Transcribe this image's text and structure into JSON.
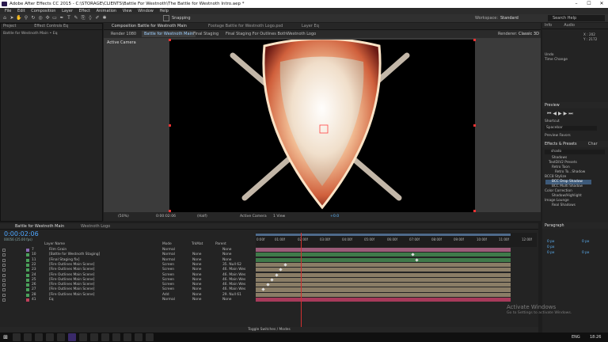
{
  "window": {
    "title": "Adobe After Effects CC 2015 - C:\\STORAGE\\CLIENTS\\Battle For Westnoth\\The Battle for Westnoth Intro.aep *",
    "controls": [
      "–",
      "☐",
      "✕"
    ]
  },
  "menu": [
    "File",
    "Edit",
    "Composition",
    "Layer",
    "Effect",
    "Animation",
    "View",
    "Window",
    "Help"
  ],
  "toolbar": {
    "snapping": "Snapping",
    "workspace_label": "Workspace:",
    "workspace_value": "Standard",
    "search_placeholder": "Search Help"
  },
  "panels": {
    "project": {
      "tab": "Project",
      "effect_controls_tab": "Effect Controls Eq",
      "subtitle": "Battle for Westnoth Main • Eq"
    },
    "composition": {
      "tab": "Composition Battle for Westnoth Main",
      "footage_tab": "Footage Battle for Westnoth Logo.psd",
      "layer_tab": "Layer Eq",
      "render_label": "Render 1080",
      "comp_tabs": [
        "Battle for Westnoth Main",
        "Final Staging",
        "Final Staging For Outlines Both",
        "Westnoth Logo"
      ],
      "renderer_label": "Renderer:",
      "renderer_value": "Classic 3D",
      "active_camera": "Active Camera"
    },
    "viewer_footer": {
      "zoom": "(50%)",
      "timecode": "0:00:02:06",
      "resolution": "(Half)",
      "camera": "Active Camera",
      "view": "1 View",
      "offset": "+0.0"
    }
  },
  "info": {
    "tab": "Info",
    "audio_tab": "Audio",
    "x": "X : 202",
    "y": "Y : 2172",
    "undo": "Undo",
    "time_change": "Time Change"
  },
  "preview": {
    "tab": "Preview",
    "shortcut_label": "Shortcut",
    "shortcut_value": "Spacebar",
    "preview_favors": "Preview Favors"
  },
  "effects": {
    "tab": "Effects & Presets",
    "chars_tab": "Char",
    "search_value": "shado",
    "items": [
      "Shadows",
      "TextDiV2 Presets",
      "Retro Toon",
      "Retro To...Shadow",
      "BCC8 Stylize",
      "BCC Drop Shadow",
      "BCC Multi Shadow",
      "Color Correction",
      "Shadow/Highlight",
      "Image Lounge",
      "Real Shadows"
    ]
  },
  "paragraph": {
    "tab": "Paragraph",
    "fields": [
      "0 px",
      "0 px",
      "0 px",
      "0 px",
      "0 px"
    ]
  },
  "timeline": {
    "tabs": [
      "Battle for Westnoth Main",
      "Westnoth Logo"
    ],
    "timecode": "0:00:02:06",
    "frame_info": "00056 (25.00 fps)",
    "headers": {
      "layer_name": "Layer Name",
      "mode": "Mode",
      "trkmat": "TrkMat",
      "parent": "Parent"
    },
    "ruler": [
      "0:00f",
      "01:00f",
      "02:00f",
      "03:00f",
      "04:00f",
      "05:00f",
      "06:00f",
      "07:00f",
      "08:00f",
      "09:00f",
      "10:00f",
      "11:00f",
      "12:00f"
    ],
    "toggle_label": "Toggle Switches / Modes",
    "layers": [
      {
        "num": "7",
        "name": "Film Grain",
        "mode": "Normal",
        "trk": "",
        "parent": "None",
        "color": "#8b6ab3",
        "track": "#9b5b78"
      },
      {
        "num": "10",
        "name": "[Battle for Westnoth Staging]",
        "mode": "Normal",
        "trk": "None",
        "parent": "None",
        "color": "#4aa15a",
        "track": "#3f7a4a"
      },
      {
        "num": "11",
        "name": "[Final Staging fix]",
        "mode": "Normal",
        "trk": "None",
        "parent": "None",
        "color": "#4aa15a",
        "track": "#3f7a4a"
      },
      {
        "num": "22",
        "name": "[Fire Outlines Main Scene]",
        "mode": "Screen",
        "trk": "None",
        "parent": "35. Null 62",
        "color": "#4aa15a",
        "track": "#8a7d66"
      },
      {
        "num": "23",
        "name": "[Fire Outlines Main Scene]",
        "mode": "Screen",
        "trk": "None",
        "parent": "46. Main Wes",
        "color": "#4aa15a",
        "track": "#8a7d66"
      },
      {
        "num": "24",
        "name": "[Fire Outlines Main Scene]",
        "mode": "Screen",
        "trk": "None",
        "parent": "46. Main Wes",
        "color": "#4aa15a",
        "track": "#8a7d66"
      },
      {
        "num": "25",
        "name": "[Fire Outlines Main Scene]",
        "mode": "Screen",
        "trk": "None",
        "parent": "46. Main Wes",
        "color": "#4aa15a",
        "track": "#8a7d66"
      },
      {
        "num": "26",
        "name": "[Fire Outlines Main Scene]",
        "mode": "Screen",
        "trk": "None",
        "parent": "46. Main Wes",
        "color": "#4aa15a",
        "track": "#8a7d66"
      },
      {
        "num": "27",
        "name": "[Fire Outlines Main Scene]",
        "mode": "Screen",
        "trk": "None",
        "parent": "46. Main Wes",
        "color": "#4aa15a",
        "track": "#8a7d66"
      },
      {
        "num": "28",
        "name": "[Fire Outlines Main Scene]",
        "mode": "Add",
        "trk": "None",
        "parent": "29. Null 61",
        "color": "#4aa15a",
        "track": "#8a7d66"
      },
      {
        "num": "41",
        "name": "Eq",
        "mode": "Normal",
        "trk": "None",
        "parent": "None",
        "color": "#c0405a",
        "track": "#a73a5a"
      }
    ]
  },
  "activate": {
    "line1": "Activate Windows",
    "line2": "Go to Settings to activate Windows."
  },
  "taskbar": {
    "lang": "ENG",
    "time": "18:26"
  }
}
